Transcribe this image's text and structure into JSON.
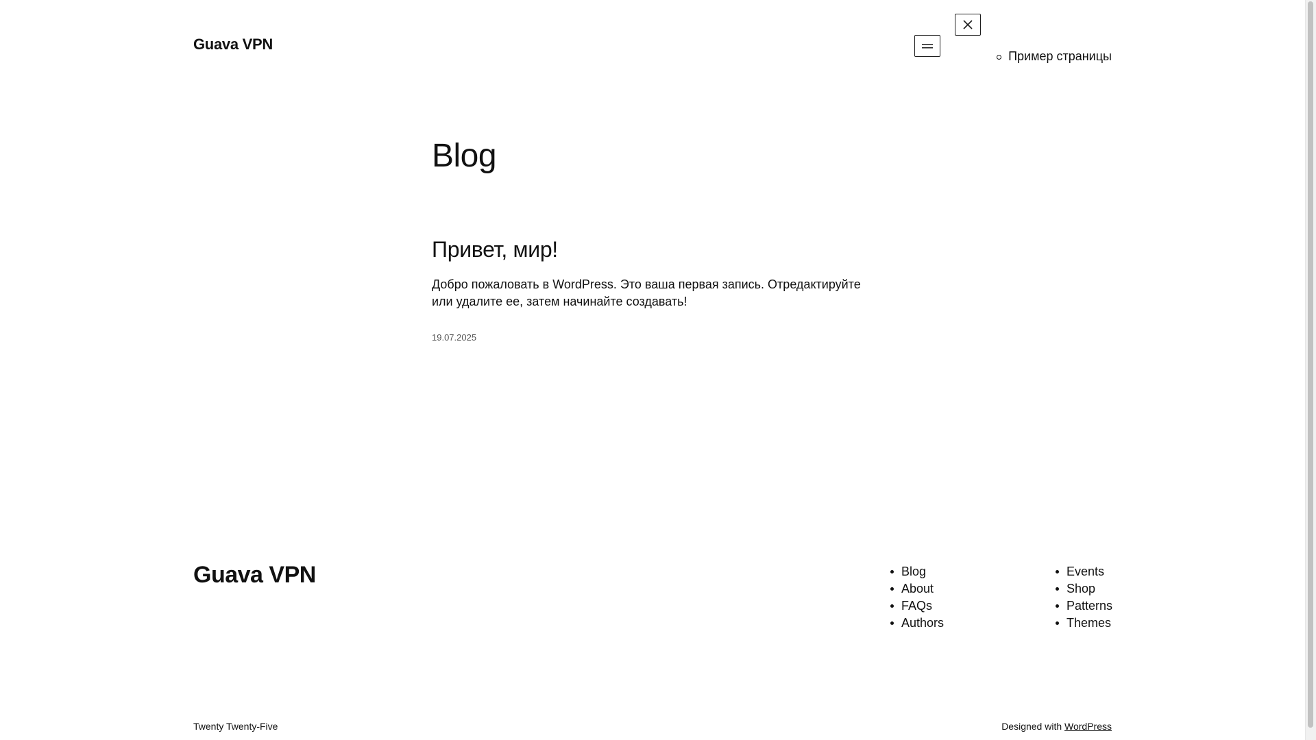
{
  "header": {
    "site_title": "Guava VPN",
    "menu_open_icon": "hamburger-icon",
    "menu_close_icon": "close-icon",
    "nav_items": [
      "Пример страницы"
    ]
  },
  "main": {
    "page_heading": "Blog",
    "post": {
      "title": "Привет, мир!",
      "excerpt": "Добро пожаловать в WordPress. Это ваша первая запись. Отредактируйте или удалите ее, затем начинайте создавать!",
      "date": "19.07.2025"
    }
  },
  "footer": {
    "site_title": "Guava VPN",
    "nav_column_1": [
      "Blog",
      "About",
      "FAQs",
      "Authors"
    ],
    "nav_column_2": [
      "Events",
      "Shop",
      "Patterns",
      "Themes"
    ],
    "theme_credit": "Twenty Twenty-Five",
    "designed_with": "Designed with",
    "designed_with_link": "WordPress"
  }
}
